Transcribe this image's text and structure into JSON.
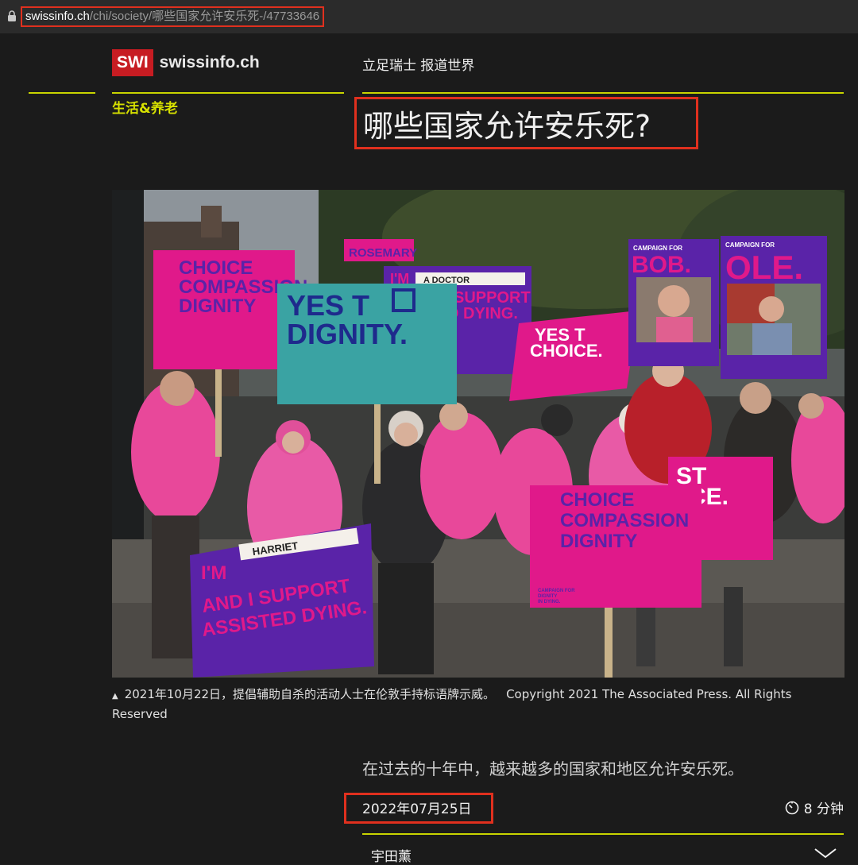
{
  "browser": {
    "url_host": "swissinfo.ch",
    "url_path": "/chi/society/哪些国家允许安乐死-/47733646"
  },
  "header": {
    "logo_mark": "SWI",
    "logo_text": "swissinfo.ch",
    "tagline": "立足瑞士 报道世界"
  },
  "article": {
    "category": "生活&养老",
    "title": "哪些国家允许安乐死?",
    "photo_caption": "2021年10月22日，提倡辅助自杀的活动人士在伦敦手持标语牌示威。",
    "photo_copyright": "Copyright 2021 The Associated Press. All Rights Reserved",
    "lead": "在过去的十年中，越来越多的国家和地区允许安乐死。",
    "date": "2022年07月25日",
    "read_time": "8 分钟",
    "author": "宇田薰"
  },
  "photo_signs": {
    "choice": "CHOICE",
    "compassion": "COMPASSION",
    "dignity": "DIGNITY",
    "yes_to": "YES T",
    "dignity_dot": "DIGNITY.",
    "choice_dot": "CHOICE.",
    "rosemary": "ROSEMARY",
    "im": "I'M",
    "doctor": "A DOCTOR",
    "support": "SUPPORT",
    "dying": "D DYING.",
    "campaign": "CAMPAIGN FOR",
    "bob": "BOB.",
    "ole": "OLE.",
    "harriet": "HARRIET",
    "and_i_support": "AND I SUPPORT",
    "assisted_dying": "ASSISTED DYING.",
    "st": "ST",
    "ce": "CE.",
    "campaign_small": "CAMPAIGN FOR",
    "dignity_small": "DIGNITY",
    "in_dying": "IN DYING."
  },
  "colors": {
    "accent_lime": "#c8d400",
    "brand_red": "#c71c22",
    "highlight_red": "#e0301e",
    "sign_pink": "#e0198a",
    "sign_purple": "#5a23a8",
    "sign_teal": "#3aa3a3",
    "hoodie_pink": "#e8489a"
  },
  "icons": {
    "lock": "lock-icon",
    "clock": "timer-icon",
    "chevron": "chevron-down-icon"
  }
}
